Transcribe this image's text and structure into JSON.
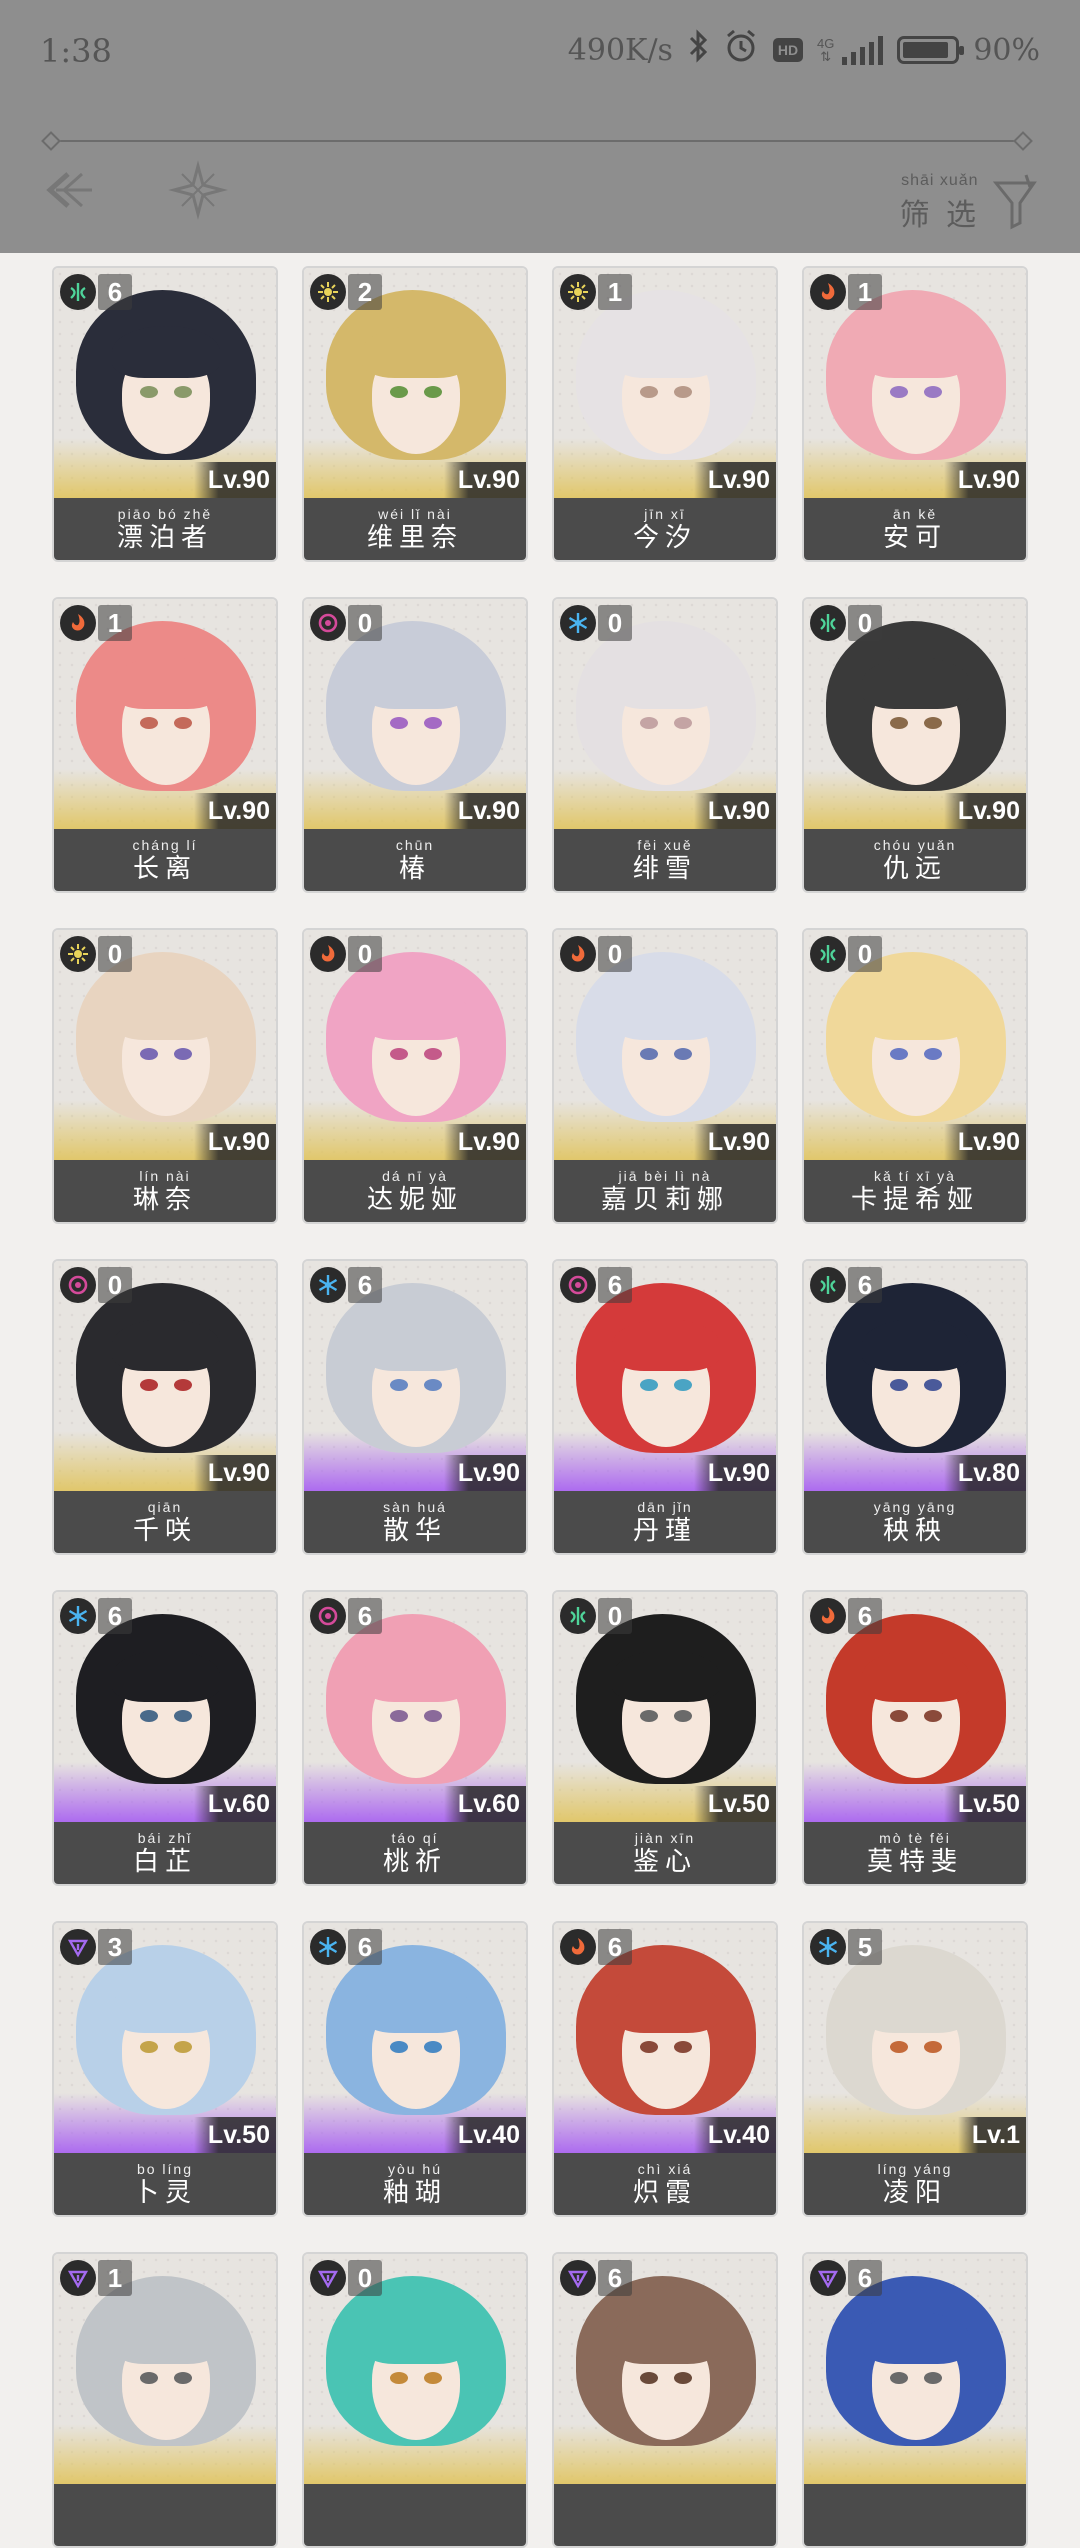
{
  "status_bar": {
    "time": "1:38",
    "net_speed": "490K/s",
    "network": "4G",
    "hd": "HD",
    "battery": "90%"
  },
  "header": {
    "filter_pinyin": "shāi xuǎn",
    "filter_label": "筛 选"
  },
  "colors": {
    "overlay": "#8e8e8e",
    "name_bar": "#4b4b4b",
    "gold_glow": "#e0c45e",
    "purple_glow": "#aa64f0"
  },
  "characters": [
    {
      "const": "6",
      "element": "aero",
      "level": "Lv.90",
      "pinyin": "piāo bó zhě",
      "name": "漂泊者",
      "rarity": "gold",
      "hair": "#2a2d3a",
      "eye": "#8a9a6a"
    },
    {
      "const": "2",
      "element": "spectro",
      "level": "Lv.90",
      "pinyin": "wéi lǐ nài",
      "name": "维里奈",
      "rarity": "gold",
      "hair": "#d4b86a",
      "eye": "#6a9a4a"
    },
    {
      "const": "1",
      "element": "spectro",
      "level": "Lv.90",
      "pinyin": "jīn xī",
      "name": "今汐",
      "rarity": "gold",
      "hair": "#e6e2e4",
      "eye": "#b89a8a"
    },
    {
      "const": "1",
      "element": "fusion",
      "level": "Lv.90",
      "pinyin": "ān kě",
      "name": "安可",
      "rarity": "gold",
      "hair": "#f0aab4",
      "eye": "#9a7ac4"
    },
    {
      "const": "1",
      "element": "fusion",
      "level": "Lv.90",
      "pinyin": "cháng lí",
      "name": "长离",
      "rarity": "gold",
      "hair": "#ec8a88",
      "eye": "#c46a5a"
    },
    {
      "const": "0",
      "element": "havoc",
      "level": "Lv.90",
      "pinyin": "chūn",
      "name": "椿",
      "rarity": "gold",
      "hair": "#c8ccd8",
      "eye": "#a46ac4"
    },
    {
      "const": "0",
      "element": "glacio",
      "level": "Lv.90",
      "pinyin": "fēi xuě",
      "name": "绯雪",
      "rarity": "gold",
      "hair": "#e4e0e2",
      "eye": "#c4a4a4"
    },
    {
      "const": "0",
      "element": "aero",
      "level": "Lv.90",
      "pinyin": "chóu yuǎn",
      "name": "仇远",
      "rarity": "gold",
      "hair": "#3a3a3a",
      "eye": "#8a6a4a"
    },
    {
      "const": "0",
      "element": "spectro",
      "level": "Lv.90",
      "pinyin": "lín nài",
      "name": "琳奈",
      "rarity": "gold",
      "hair": "#e8d4c0",
      "eye": "#7a6ab4"
    },
    {
      "const": "0",
      "element": "fusion",
      "level": "Lv.90",
      "pinyin": "dá nī yà",
      "name": "达妮娅",
      "rarity": "gold",
      "hair": "#f0a4c4",
      "eye": "#c45a8a"
    },
    {
      "const": "0",
      "element": "fusion",
      "level": "Lv.90",
      "pinyin": "jiā bèi lì nà",
      "name": "嘉贝莉娜",
      "rarity": "gold",
      "hair": "#d8dce8",
      "eye": "#6a7ab4"
    },
    {
      "const": "0",
      "element": "aero",
      "level": "Lv.90",
      "pinyin": "kǎ tí xī yà",
      "name": "卡提希娅",
      "rarity": "gold",
      "hair": "#f0d89a",
      "eye": "#6a7ac4"
    },
    {
      "const": "0",
      "element": "havoc",
      "level": "Lv.90",
      "pinyin": "qiān",
      "name": "千咲",
      "rarity": "gold",
      "hair": "#2a2a2e",
      "eye": "#b43a3a"
    },
    {
      "const": "6",
      "element": "glacio",
      "level": "Lv.90",
      "pinyin": "sàn huá",
      "name": "散华",
      "rarity": "purple",
      "hair": "#c8ccd4",
      "eye": "#6a8ac4"
    },
    {
      "const": "6",
      "element": "havoc",
      "level": "Lv.90",
      "pinyin": "dān jǐn",
      "name": "丹瑾",
      "rarity": "purple",
      "hair": "#d43a3a",
      "eye": "#4aa4c4"
    },
    {
      "const": "6",
      "element": "aero",
      "level": "Lv.80",
      "pinyin": "yāng yāng",
      "name": "秧秧",
      "rarity": "purple",
      "hair": "#1e2436",
      "eye": "#4a5a9a"
    },
    {
      "const": "6",
      "element": "glacio",
      "level": "Lv.60",
      "pinyin": "bái zhǐ",
      "name": "白芷",
      "rarity": "purple",
      "hair": "#1e1e22",
      "eye": "#4a6a8a"
    },
    {
      "const": "6",
      "element": "havoc",
      "level": "Lv.60",
      "pinyin": "táo qí",
      "name": "桃祈",
      "rarity": "purple",
      "hair": "#f0a0b4",
      "eye": "#8a6a9a"
    },
    {
      "const": "0",
      "element": "aero",
      "level": "Lv.50",
      "pinyin": "jiàn xīn",
      "name": "鉴心",
      "rarity": "gold",
      "hair": "#1e1e1e",
      "eye": "#6a6a6a"
    },
    {
      "const": "6",
      "element": "fusion",
      "level": "Lv.50",
      "pinyin": "mò tè fěi",
      "name": "莫特斐",
      "rarity": "purple",
      "hair": "#c43a2a",
      "eye": "#8a4a3a"
    },
    {
      "const": "3",
      "element": "electro",
      "level": "Lv.50",
      "pinyin": "bo líng",
      "name": "卜灵",
      "rarity": "purple",
      "hair": "#b8d0e8",
      "eye": "#c4a44a"
    },
    {
      "const": "6",
      "element": "glacio",
      "level": "Lv.40",
      "pinyin": "yòu hú",
      "name": "釉瑚",
      "rarity": "purple",
      "hair": "#8ab4e0",
      "eye": "#4a8ac4"
    },
    {
      "const": "6",
      "element": "fusion",
      "level": "Lv.40",
      "pinyin": "chì xiá",
      "name": "炽霞",
      "rarity": "purple",
      "hair": "#c44a3a",
      "eye": "#8a4a3a"
    },
    {
      "const": "5",
      "element": "glacio",
      "level": "Lv.1",
      "pinyin": "líng yáng",
      "name": "凌阳",
      "rarity": "gold",
      "hair": "#dcd8d0",
      "eye": "#c46a3a"
    },
    {
      "const": "1",
      "element": "electro",
      "level": "",
      "pinyin": "",
      "name": "",
      "rarity": "gold",
      "hair": "#c0c4c8",
      "eye": "#6a6a6a"
    },
    {
      "const": "0",
      "element": "electro",
      "level": "",
      "pinyin": "",
      "name": "",
      "rarity": "gold",
      "hair": "#4ac4b4",
      "eye": "#c48a3a"
    },
    {
      "const": "6",
      "element": "electro",
      "level": "",
      "pinyin": "",
      "name": "",
      "rarity": "gold",
      "hair": "#8a6a5a",
      "eye": "#6a4a3a"
    },
    {
      "const": "6",
      "element": "electro",
      "level": "",
      "pinyin": "",
      "name": "",
      "rarity": "gold",
      "hair": "#3a5ab4",
      "eye": "#6a6a6a"
    }
  ]
}
